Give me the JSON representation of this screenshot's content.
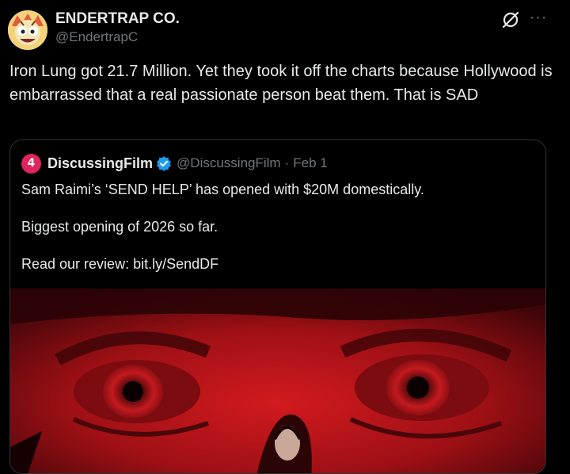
{
  "author": {
    "display_name": "ENDERTRAP CO.",
    "handle": "@EndertrapC"
  },
  "header_icons": {
    "grok": "grok-icon",
    "more": "more-options-icon",
    "more_glyph": "···"
  },
  "tweet": {
    "text": "Iron Lung got 21.7 Million. Yet they took it off the charts because Hollywood is embarrassed that a real passionate person beat them. That is SAD"
  },
  "quote": {
    "avatar_glyph": "4",
    "display_name": "DiscussingFilm",
    "verified": true,
    "handle": "@DiscussingFilm",
    "separator": "·",
    "date": "Feb 1",
    "lines": [
      "Sam Raimi’s ‘SEND HELP’ has opened with $20M domestically.",
      "Biggest opening of 2026 so far.",
      "Read our review: bit.ly/SendDF"
    ]
  },
  "colors": {
    "background": "#000000",
    "text_primary": "#e7e9ea",
    "text_secondary": "#71767b",
    "border": "#2f3336",
    "verified_badge": "#1d9bf0",
    "poster_red": "#b0141a"
  }
}
